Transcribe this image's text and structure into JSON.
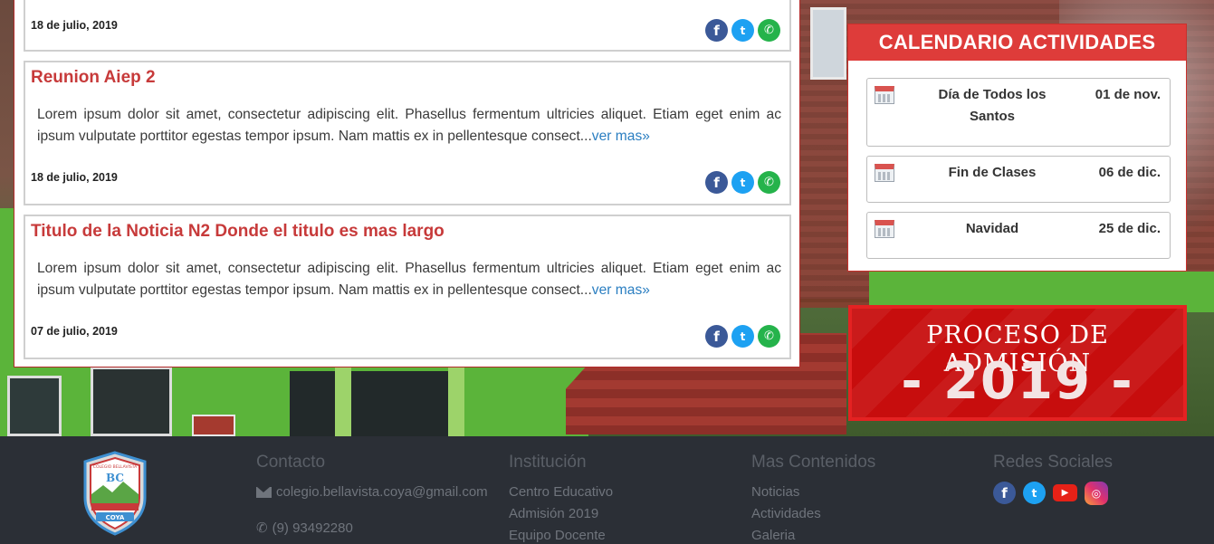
{
  "news": [
    {
      "title": "",
      "text": "",
      "ver_mas": "",
      "date": "18 de julio, 2019"
    },
    {
      "title": "Reunion Aiep 2",
      "text": "Lorem ipsum dolor sit amet, consectetur adipiscing elit. Phasellus fermentum ultricies aliquet. Etiam eget enim ac ipsum vulputate porttitor egestas tempor ipsum. Nam mattis ex in pellentesque consect...",
      "ver_mas": "ver mas»",
      "date": "18 de julio, 2019"
    },
    {
      "title": "Titulo de la Noticia N2 Donde el titulo es mas largo",
      "text": "Lorem ipsum dolor sit amet, consectetur adipiscing elit. Phasellus fermentum ultricies aliquet. Etiam eget enim ac ipsum vulputate porttitor egestas tempor ipsum. Nam mattis ex in pellentesque consect...",
      "ver_mas": "ver mas»",
      "date": "07 de julio, 2019"
    }
  ],
  "share_icons": {
    "facebook": "f",
    "twitter": "t",
    "whatsapp": "✆"
  },
  "calendar": {
    "title": "CALENDARIO ACTIVIDADES",
    "items": [
      {
        "name": "Día de Todos los Santos",
        "date": "01 de nov."
      },
      {
        "name": "Fin de Clases",
        "date": "06 de dic."
      },
      {
        "name": "Navidad",
        "date": "25 de dic."
      }
    ]
  },
  "admission": {
    "line1": "PROCESO DE ADMISIÓN",
    "line2": "- 2019 -"
  },
  "footer": {
    "contacto": {
      "heading": "Contacto",
      "email": "colegio.bellavista.coya@gmail.com",
      "phone": "(9) 93492280"
    },
    "institucion": {
      "heading": "Institución",
      "links": [
        "Centro Educativo",
        "Admisión 2019",
        "Equipo Docente"
      ]
    },
    "mas_contenidos": {
      "heading": "Mas Contenidos",
      "links": [
        "Noticias",
        "Actividades",
        "Galeria"
      ]
    },
    "redes": {
      "heading": "Redes Sociales",
      "icons": [
        "facebook-icon",
        "twitter-icon",
        "youtube-icon",
        "instagram-icon"
      ]
    },
    "logo": {
      "top_text": "COLEGIO BELLAVISTA",
      "bottom_text": "COYA",
      "monogram": "BC"
    }
  },
  "colors": {
    "accent_red": "#de3c3a",
    "link_blue": "#2a7ec1",
    "footer_bg": "#2b2f36"
  }
}
